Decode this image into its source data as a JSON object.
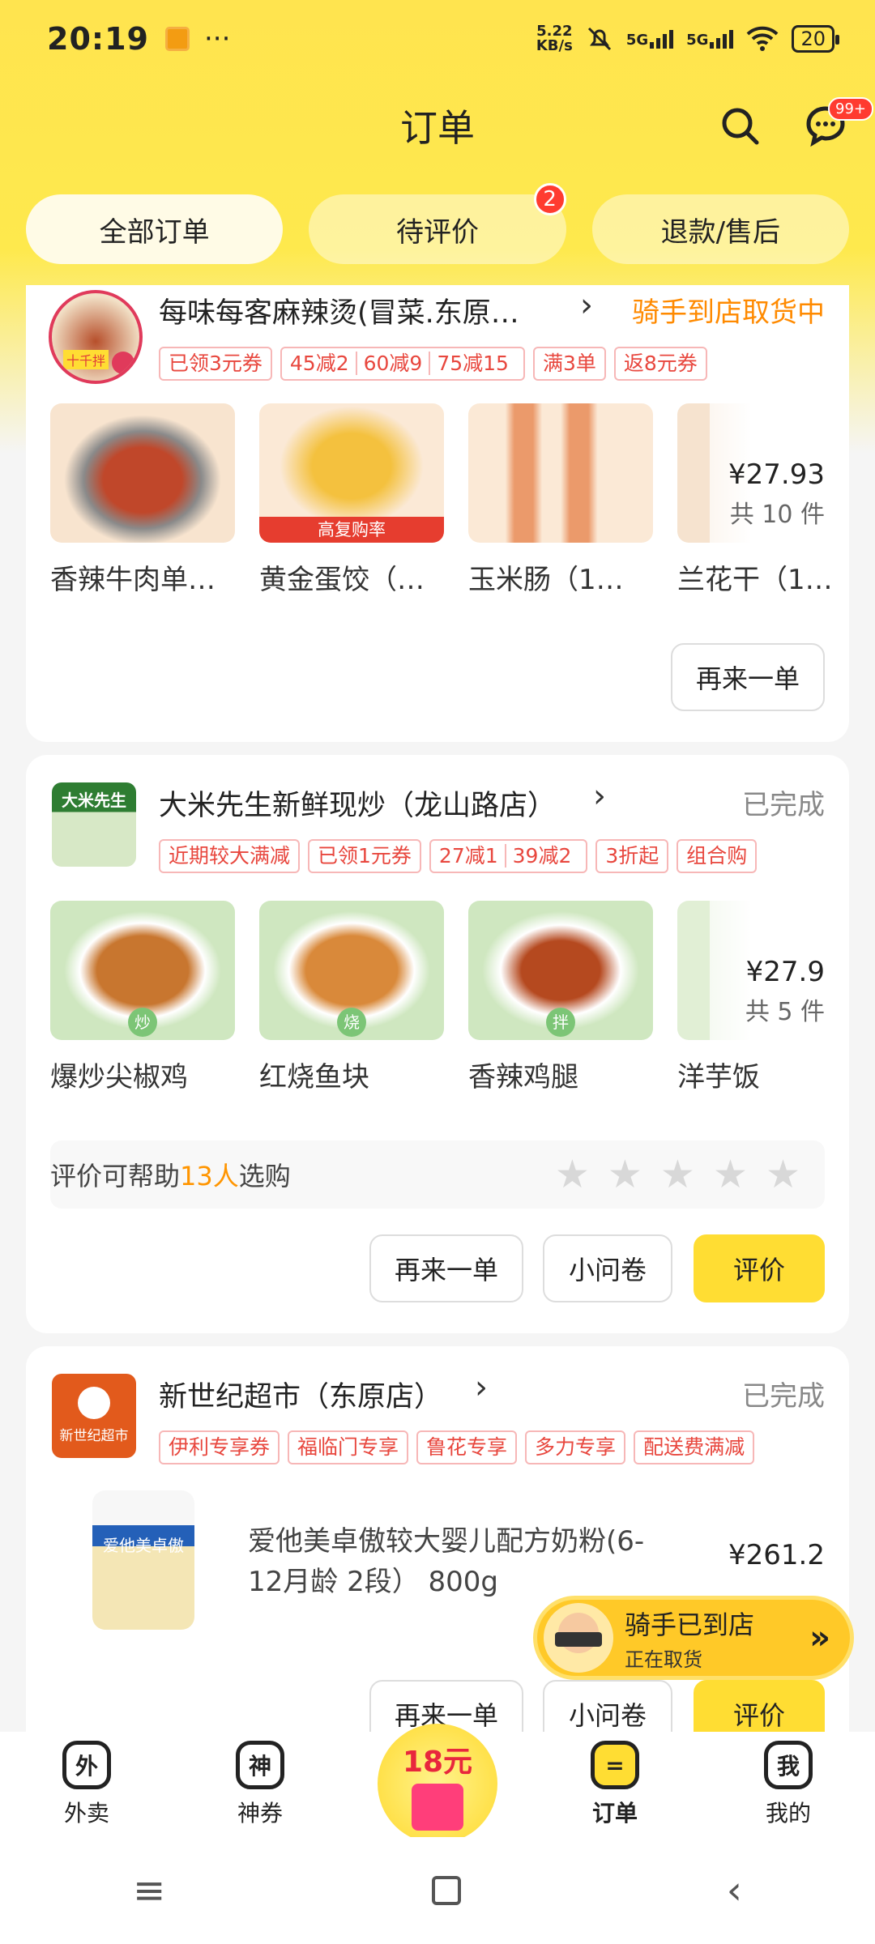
{
  "status_bar": {
    "time": "20:19",
    "net_speed_value": "5.22",
    "net_speed_unit": "KB/s",
    "sig1": "5G",
    "sig2": "5G",
    "battery": "20"
  },
  "header": {
    "title": "订单",
    "msg_badge": "99+"
  },
  "tabs": [
    {
      "label": "全部订单"
    },
    {
      "label": "待评价",
      "badge": "2"
    },
    {
      "label": "退款/售后"
    }
  ],
  "orders": [
    {
      "shop": "每味每客麻辣烫(冒菜.东原…",
      "status": "骑手到店取货中",
      "logo_text": "十千拌",
      "tags": [
        "已领3元券",
        "45减2",
        "60减9",
        "75减15",
        "满3单",
        "返8元券"
      ],
      "items": [
        {
          "name": "香辣牛肉单…"
        },
        {
          "name": "黄金蛋饺（…",
          "label": "高复购率"
        },
        {
          "name": "玉米肠（1…"
        },
        {
          "name": "兰花干（1…"
        }
      ],
      "price": "¥27.93",
      "count": "共 10 件",
      "buttons": [
        "再来一单"
      ]
    },
    {
      "shop": "大米先生新鲜现炒（龙山路店）",
      "status": "已完成",
      "logo_text": "大米先生",
      "tags": [
        "近期较大满减",
        "已领1元券",
        "27减1",
        "39减2",
        "3折起",
        "组合购"
      ],
      "items": [
        {
          "name": "爆炒尖椒鸡",
          "mark": "炒"
        },
        {
          "name": "红烧鱼块",
          "mark": "烧"
        },
        {
          "name": "香辣鸡腿",
          "mark": "拌"
        },
        {
          "name": "洋芋饭"
        }
      ],
      "price": "¥27.9",
      "count": "共 5 件",
      "rate_prefix": "评价可帮助",
      "rate_count": "13人",
      "rate_suffix": "选购",
      "buttons": [
        "再来一单",
        "小问卷",
        "评价"
      ]
    },
    {
      "shop": "新世纪超市（东原店）",
      "status": "已完成",
      "logo_text": "新世纪超市",
      "tags": [
        "伊利专享券",
        "福临门专享",
        "鲁花专享",
        "多力专享",
        "配送费满减"
      ],
      "product_name": "爱他美卓傲较大婴儿配方奶粉(6-12月龄 2段） 800g",
      "product_logo": "爱他美卓傲",
      "price": "¥261.2",
      "buttons": [
        "再来一单",
        "小问卷",
        "评价"
      ]
    }
  ],
  "rider": {
    "title": "骑手已到店",
    "sub": "正在取货"
  },
  "bottom_nav": [
    {
      "label": "外卖",
      "icon": "外"
    },
    {
      "label": "神券",
      "icon": "神"
    },
    {
      "label": "订单",
      "icon": "="
    },
    {
      "label": "我的",
      "icon": "我"
    }
  ],
  "promo": {
    "amount": "18元"
  },
  "colors": {
    "brand_yellow": "#ffdd33",
    "status_orange": "#ff8a00",
    "tag_red": "#e8473e"
  }
}
